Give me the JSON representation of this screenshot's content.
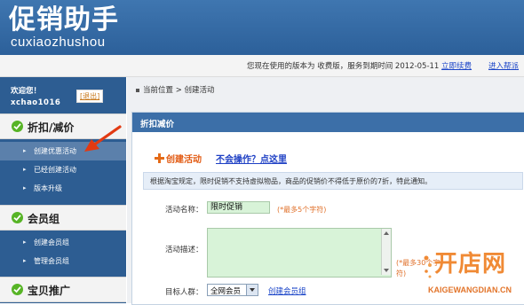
{
  "header": {
    "logo_title": "促销助手",
    "logo_subtitle": "cuxiaozhushou"
  },
  "infobar": {
    "version_text": "您现在使用的版本为 收费版，服务到期时间 2012-05-11",
    "renew_link": "立即续费",
    "help_link": "进入帮派"
  },
  "sidebar": {
    "welcome": "欢迎您！",
    "logout": "[退出]",
    "username": "xchao1016",
    "sections": [
      {
        "label": "折扣/减价",
        "items": [
          "创建优惠活动",
          "已经创建活动",
          "版本升级"
        ],
        "selected_index": 0
      },
      {
        "label": "会员组",
        "items": [
          "创建会员组",
          "管理会员组"
        ]
      },
      {
        "label": "宝贝推广",
        "items": []
      }
    ]
  },
  "breadcrumb": {
    "current": "当前位置",
    "separator": ">",
    "page": "创建活动"
  },
  "panel": {
    "title": "折扣减价",
    "create_title": "创建活动",
    "help_link": "不会操作？点这里",
    "notice": "根据淘宝规定，限时促销不支持虚拟物品，商品的促销价不得低于原价的7折，特此通知。",
    "form": {
      "name_label": "活动名称：",
      "name_value": "限时促销",
      "name_hint": "(*最多5个字符)",
      "desc_label": "活动描述：",
      "desc_value": "",
      "desc_hint_1": "(*最多30个字",
      "desc_hint_2": "符)",
      "target_label": "目标人群：",
      "target_value": "全网会员",
      "target_link": "创建会员组"
    }
  },
  "watermark": {
    "cn": "开店网",
    "en": "KAIGEWANGDIAN.CN"
  },
  "colors": {
    "header_blue": "#2c609a",
    "sidebar_blue": "#2d5d92",
    "accent_orange": "#e25a12",
    "link_blue": "#1b45c8",
    "input_green": "#d8f3d8",
    "check_green": "#57b426"
  },
  "icons": {
    "section": "check-circle-icon",
    "create": "plus-icon",
    "pointer": "red-arrow-icon"
  }
}
